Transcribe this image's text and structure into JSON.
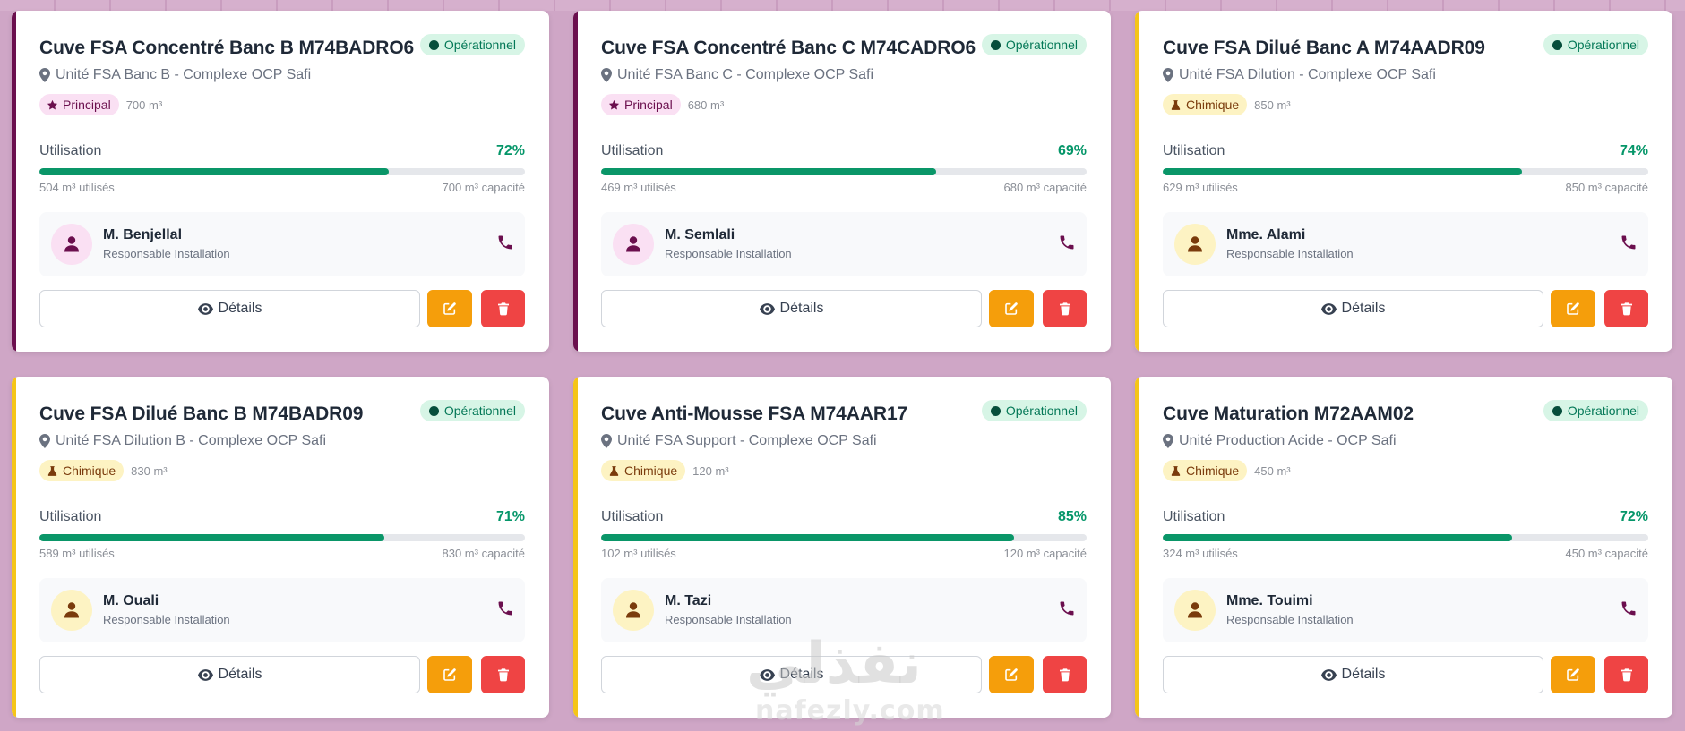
{
  "labels": {
    "usage": "Utilisation",
    "details": "Détails",
    "used_suffix": "utilisés",
    "cap_suffix": "capacité"
  },
  "colors": {
    "principal_accent": "#6b0f4e",
    "chimique_accent": "#f5c518",
    "progress": "#0a9668",
    "status_bg": "#d7f5e6",
    "edit": "#f59e0b",
    "delete": "#ef4444"
  },
  "cards": [
    {
      "title": "Cuve FSA Concentré Banc B M74BADRO6",
      "status": "Opérationnel",
      "location": "Unité FSA Banc B - Complexe OCP Safi",
      "tag": "Principal",
      "tag_icon": "star-icon",
      "volume": "700 m³",
      "percent": "72%",
      "fraction": 0.72,
      "used": "504 m³ utilisés",
      "capacity": "700 m³ capacité",
      "contact_name": "M. Benjellal",
      "contact_role": "Responsable Installation"
    },
    {
      "title": "Cuve FSA Concentré Banc C M74CADRO6",
      "status": "Opérationnel",
      "location": "Unité FSA Banc C - Complexe OCP Safi",
      "tag": "Principal",
      "tag_icon": "star-icon",
      "volume": "680 m³",
      "percent": "69%",
      "fraction": 0.69,
      "used": "469 m³ utilisés",
      "capacity": "680 m³ capacité",
      "contact_name": "M. Semlali",
      "contact_role": "Responsable Installation"
    },
    {
      "title": "Cuve FSA Dilué Banc A M74AADR09",
      "status": "Opérationnel",
      "location": "Unité FSA Dilution - Complexe OCP Safi",
      "tag": "Chimique",
      "tag_icon": "flask-icon",
      "volume": "850 m³",
      "percent": "74%",
      "fraction": 0.74,
      "used": "629 m³ utilisés",
      "capacity": "850 m³ capacité",
      "contact_name": "Mme. Alami",
      "contact_role": "Responsable Installation"
    },
    {
      "title": "Cuve FSA Dilué Banc B M74BADR09",
      "status": "Opérationnel",
      "location": "Unité FSA Dilution B - Complexe OCP Safi",
      "tag": "Chimique",
      "tag_icon": "flask-icon",
      "volume": "830 m³",
      "percent": "71%",
      "fraction": 0.71,
      "used": "589 m³ utilisés",
      "capacity": "830 m³ capacité",
      "contact_name": "M. Ouali",
      "contact_role": "Responsable Installation"
    },
    {
      "title": "Cuve Anti-Mousse FSA M74AAR17",
      "status": "Opérationnel",
      "location": "Unité FSA Support - Complexe OCP Safi",
      "tag": "Chimique",
      "tag_icon": "flask-icon",
      "volume": "120 m³",
      "percent": "85%",
      "fraction": 0.85,
      "used": "102 m³ utilisés",
      "capacity": "120 m³ capacité",
      "contact_name": "M. Tazi",
      "contact_role": "Responsable Installation"
    },
    {
      "title": "Cuve Maturation M72AAM02",
      "status": "Opérationnel",
      "location": "Unité Production Acide - OCP Safi",
      "tag": "Chimique",
      "tag_icon": "flask-icon",
      "volume": "450 m³",
      "percent": "72%",
      "fraction": 0.72,
      "used": "324 m³ utilisés",
      "capacity": "450 m³ capacité",
      "contact_name": "Mme. Touimi",
      "contact_role": "Responsable Installation"
    }
  ],
  "watermark": {
    "arabic": "نفذلي",
    "latin": "nafezly.com"
  }
}
